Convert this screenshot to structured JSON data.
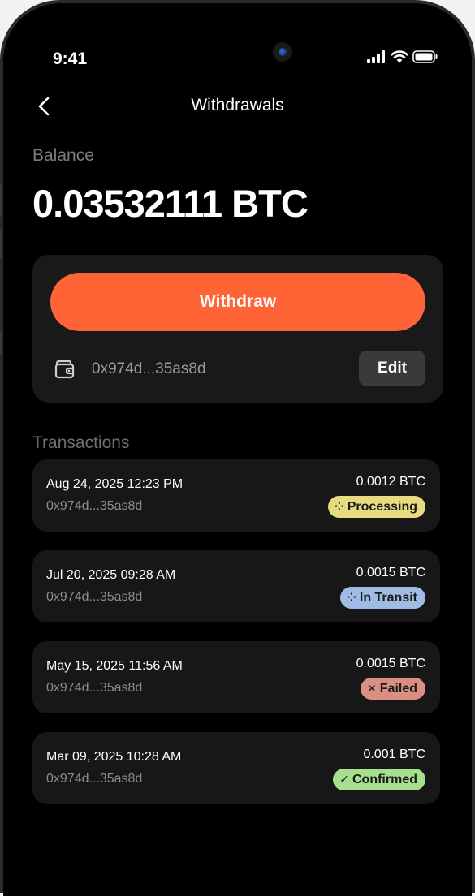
{
  "status_bar": {
    "time": "9:41"
  },
  "nav": {
    "title": "Withdrawals",
    "back_icon": "chevron-left-icon"
  },
  "balance": {
    "label": "Balance",
    "value": "0.03532111 BTC"
  },
  "withdraw_card": {
    "withdraw_label": "Withdraw",
    "wallet_address": "0x974d...35as8d",
    "edit_label": "Edit",
    "accent": "#ff6437"
  },
  "transactions": {
    "heading": "Transactions",
    "items": [
      {
        "date": "Aug 24, 2025 12:23 PM",
        "address": "0x974d...35as8d",
        "amount": "0.0012 BTC",
        "status": "Processing",
        "status_icon": "spinner-icon",
        "glyph": "⁘",
        "badge_color": "#e4dc7e"
      },
      {
        "date": "Jul 20, 2025 09:28 AM",
        "address": "0x974d...35as8d",
        "amount": "0.0015 BTC",
        "status": "In Transit",
        "status_icon": "spinner-icon",
        "glyph": "⁘",
        "badge_color": "#9fbde4"
      },
      {
        "date": "May 15, 2025 11:56 AM",
        "address": "0x974d...35as8d",
        "amount": "0.0015 BTC",
        "status": "Failed",
        "status_icon": "x-icon",
        "glyph": "✕",
        "badge_color": "#d98f82"
      },
      {
        "date": "Mar 09, 2025 10:28 AM",
        "address": "0x974d...35as8d",
        "amount": "0.001 BTC",
        "status": "Confirmed",
        "status_icon": "check-icon",
        "glyph": "✓",
        "badge_color": "#a6e08f"
      }
    ]
  }
}
